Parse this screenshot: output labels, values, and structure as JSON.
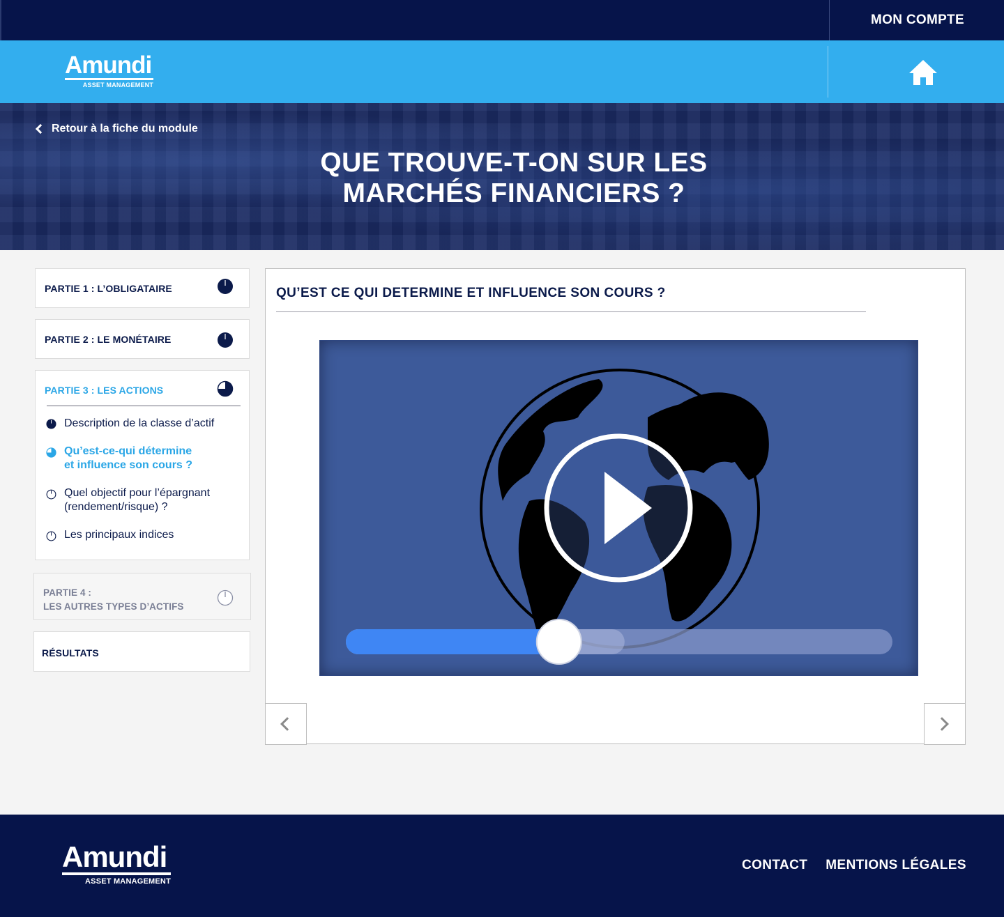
{
  "topbar": {
    "account_label": "MON COMPTE"
  },
  "header": {
    "logo": {
      "word": "Amundi",
      "sub": "ASSET MANAGEMENT"
    },
    "home_icon": "home-icon"
  },
  "hero": {
    "back_label": "Retour à la fiche du module",
    "title": "QUE TROUVE-T-ON SUR LES MARCHÉS FINANCIERS ?"
  },
  "sidebar": {
    "parts": [
      {
        "label": "PARTIE 1 : L’OBLIGATAIRE",
        "progress": 1.0,
        "state": "complete"
      },
      {
        "label": "PARTIE 2 : LE MONÉTAIRE",
        "progress": 1.0,
        "state": "complete"
      },
      {
        "label": "PARTIE 3 : LES ACTIONS",
        "progress": 0.75,
        "state": "active",
        "items": [
          {
            "label": "Description de la classe d’actif",
            "progress": 1.0,
            "state": "complete"
          },
          {
            "label": "Qu’est-ce-qui détermine et influence son cours ?",
            "progress": 0.75,
            "state": "active"
          },
          {
            "label": "Quel objectif pour l’épargnant (rendement/risque) ?",
            "progress": 0.0,
            "state": "todo"
          },
          {
            "label": "Les principaux indices",
            "progress": 0.0,
            "state": "todo"
          }
        ]
      },
      {
        "label_line1": "PARTIE 4 :",
        "label_line2": "LES AUTRES TYPES D’ACTIFS",
        "progress": 0.0,
        "state": "locked"
      }
    ],
    "results_label": "RÉSULTATS"
  },
  "main": {
    "title": "QU’EST CE QUI DETERMINE ET INFLUENCE SON COURS ?",
    "video": {
      "progress": 0.39,
      "buffered": 0.51,
      "play_icon": "play-icon"
    },
    "prev_icon": "chevron-left-icon",
    "next_icon": "chevron-right-icon"
  },
  "footer": {
    "logo": {
      "word": "Amundi",
      "sub": "ASSET MANAGEMENT"
    },
    "links": [
      "CONTACT",
      "MENTIONS LÉGALES"
    ]
  },
  "colors": {
    "navy": "#06144a",
    "sky": "#33aeee",
    "accent": "#2aa6e6",
    "slider": "#3f86f4"
  }
}
